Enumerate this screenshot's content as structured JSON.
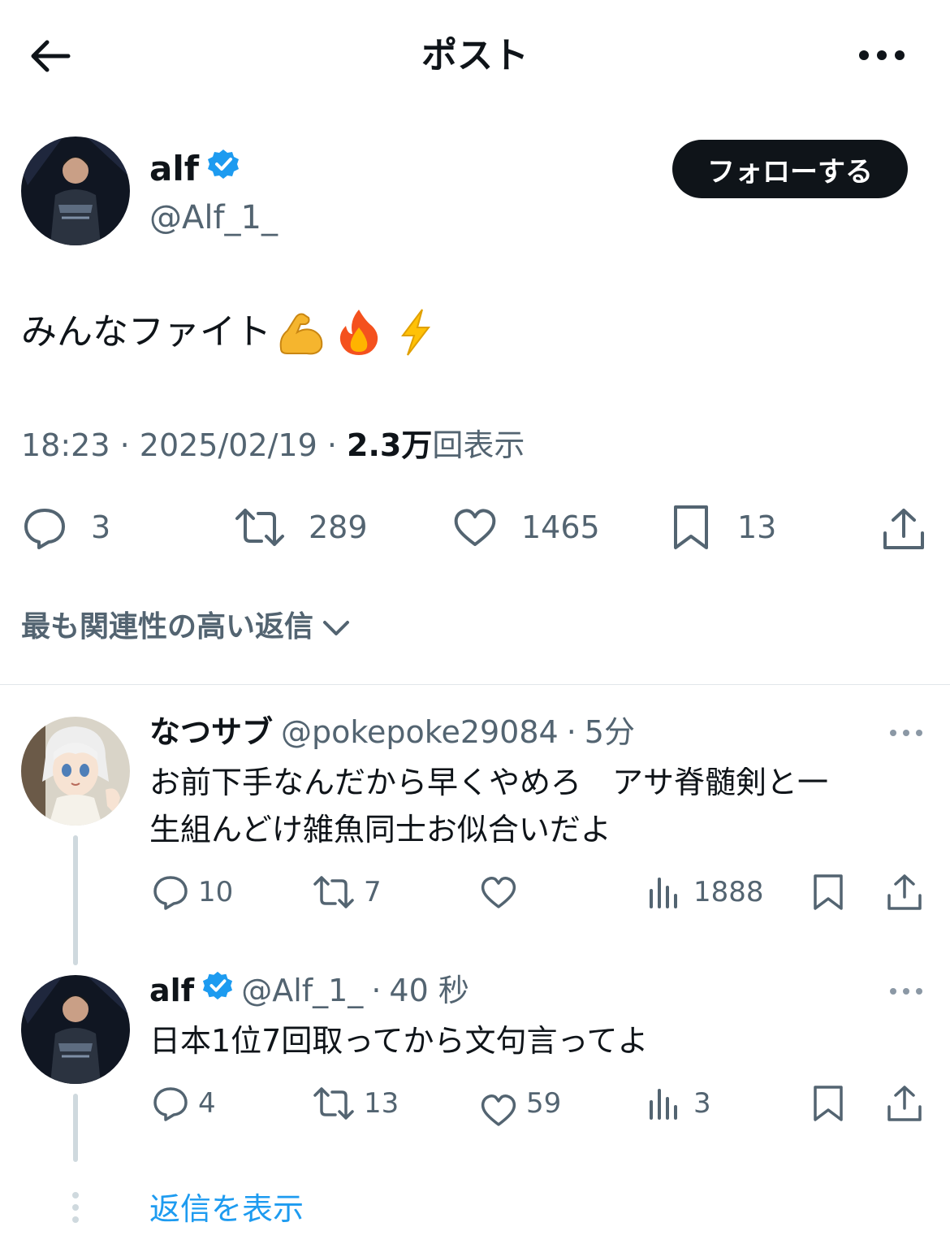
{
  "header": {
    "title": "ポスト"
  },
  "post": {
    "author_name": "alf",
    "author_handle": "@Alf_1_",
    "follow_label": "フォローする",
    "text": "みんなファイト",
    "emojis": [
      "flexed-biceps",
      "fire",
      "high-voltage"
    ],
    "time": "18:23",
    "date": "2025/02/19",
    "views_count": "2.3万",
    "views_label": "回表示",
    "stats": {
      "replies": "3",
      "reposts": "289",
      "likes": "1465",
      "bookmarks": "13"
    }
  },
  "replies_sort": {
    "label": "最も関連性の高い返信"
  },
  "replies": [
    {
      "name": "なつサブ",
      "handle": "@pokepoke29084",
      "time": "5分",
      "text_line1": "お前下手なんだから早くやめろ　アサ脊髄剣と一",
      "text_line2": "生組んどけ雑魚同士お似合いだよ",
      "replies": "10",
      "reposts": "7",
      "likes": "",
      "views": "1888"
    },
    {
      "name": "alf",
      "handle": "@Alf_1_",
      "time": "40 秒",
      "text_line1": "日本1位7回取ってから文句言ってよ",
      "replies": "4",
      "reposts": "13",
      "likes": "59",
      "views": "3"
    }
  ],
  "show_replies_label": "返信を表示",
  "colors": {
    "text": "#0f1419",
    "secondary": "#536471",
    "verified": "#1d9bf0",
    "link": "#1d9bf0",
    "follow_bg": "#0f1419"
  }
}
